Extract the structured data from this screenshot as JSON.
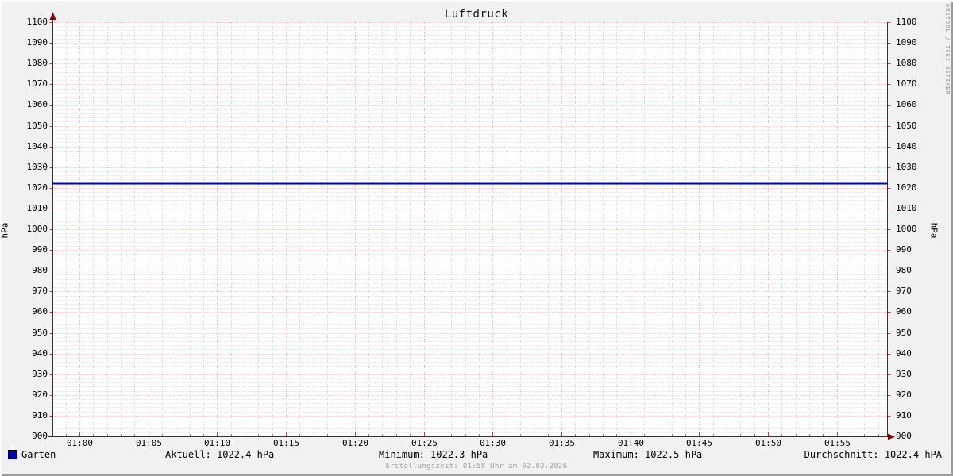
{
  "title": "Luftdruck",
  "watermark": "RRDTOOL / TOBI OETIKER",
  "footer": "Erstellungszeit: 01:58 Uhr am 02.03.2026",
  "axis": {
    "left_label": "hPa",
    "right_label": "hPa"
  },
  "legend": {
    "series_label": "Garten",
    "series_color": "#0000b4",
    "stats": [
      {
        "name": "aktuell",
        "text": "Aktuell: 1022.4 hPa"
      },
      {
        "name": "minimum",
        "text": "Minimum: 1022.3 hPa"
      },
      {
        "name": "maximum",
        "text": "Maximum: 1022.5 hPa"
      },
      {
        "name": "durchschnitt",
        "text": "Durchschnitt: 1022.4 hPA"
      }
    ]
  },
  "chart_data": {
    "type": "line",
    "title": "Luftdruck",
    "ylabel": "hPa",
    "ylim": [
      900,
      1100
    ],
    "y_tick_step": 10,
    "y_minor_step": 2,
    "y_ticks": [
      1100,
      1090,
      1080,
      1070,
      1060,
      1050,
      1040,
      1030,
      1020,
      1010,
      1000,
      990,
      980,
      970,
      960,
      950,
      940,
      930,
      920,
      910,
      900
    ],
    "x_tick_labels": [
      "01:00",
      "01:05",
      "01:10",
      "01:15",
      "01:20",
      "01:25",
      "01:30",
      "01:35",
      "01:40",
      "01:45",
      "01:50",
      "01:55"
    ],
    "x_minor_per_major": 5,
    "grid": true,
    "legend_position": "bottom",
    "series": [
      {
        "name": "Garten",
        "color": "#0000c8",
        "value": 1022.4,
        "current": 1022.4,
        "min": 1022.3,
        "max": 1022.5,
        "avg": 1022.4,
        "unit": "hPa"
      }
    ],
    "colors": {
      "background": "#f1f1f1",
      "canvas": "#ffffff",
      "major_grid": "rgba(255,0,0,0.35)",
      "minor_grid": "rgba(0,0,0,0.17)",
      "axis": "#333333",
      "arrow": "#8b0000",
      "major_tick": "#c04040",
      "minor_tick": "#888888"
    }
  }
}
